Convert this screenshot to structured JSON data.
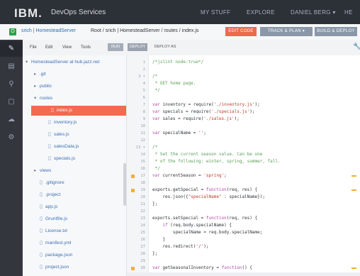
{
  "header": {
    "logo": "IBM.",
    "service": "DevOps Services",
    "nav": [
      "MY STUFF",
      "EXPLORE",
      "DANIEL BERG ▾",
      "HE"
    ]
  },
  "project": {
    "icon_letter": "O",
    "owner": "srich",
    "separator": " | ",
    "name": "HomesteadServer",
    "path": "Root / srich | HomesteadServer / routes / index.js",
    "buttons": {
      "edit": "EDIT CODE",
      "track": "TRACK & PLAN  ▾",
      "build": "BUILD & DEPLOY"
    }
  },
  "rail": {
    "icons": [
      "pencil-icon",
      "clipboard-icon",
      "search-icon",
      "window-icon",
      "cloud-icon",
      "gear-icon"
    ],
    "glyphs": [
      "✎",
      "▤",
      "⚲",
      "▢",
      "☁",
      "⚙"
    ]
  },
  "toolbar": {
    "menus": [
      "File",
      "Edit",
      "View",
      "Tools"
    ],
    "run": "RUN",
    "deploy": "DEPLOY",
    "deploy_as": "DEPLOY AS"
  },
  "tree": [
    {
      "label": "HomesteadServer at hub.jazz.net",
      "depth": 0,
      "kind": "folder-open"
    },
    {
      "label": ".git",
      "depth": 1,
      "kind": "folder"
    },
    {
      "label": "public",
      "depth": 1,
      "kind": "folder"
    },
    {
      "label": "routes",
      "depth": 1,
      "kind": "folder-open"
    },
    {
      "label": "index.js",
      "depth": 2,
      "kind": "file",
      "selected": true
    },
    {
      "label": "inventory.js",
      "depth": 2,
      "kind": "file"
    },
    {
      "label": "sales.js",
      "depth": 2,
      "kind": "file"
    },
    {
      "label": "salesData.js",
      "depth": 2,
      "kind": "file"
    },
    {
      "label": "specials.js",
      "depth": 2,
      "kind": "file"
    },
    {
      "label": "views",
      "depth": 1,
      "kind": "folder"
    },
    {
      "label": ".gitignore",
      "depth": 1,
      "kind": "file"
    },
    {
      "label": ".project",
      "depth": 1,
      "kind": "file"
    },
    {
      "label": "app.js",
      "depth": 1,
      "kind": "file"
    },
    {
      "label": "Gruntfile.js",
      "depth": 1,
      "kind": "file"
    },
    {
      "label": "License.txt",
      "depth": 1,
      "kind": "file"
    },
    {
      "label": "manifest.yml",
      "depth": 1,
      "kind": "file"
    },
    {
      "label": "package.json",
      "depth": 1,
      "kind": "file"
    },
    {
      "label": "project.json",
      "depth": 1,
      "kind": "file"
    }
  ],
  "editor": {
    "lines": [
      {
        "n": "1",
        "seg": [
          [
            "c",
            "/*jslint node:true*/"
          ]
        ]
      },
      {
        "n": "2",
        "seg": []
      },
      {
        "n": "3 ▾",
        "seg": [
          [
            "c",
            "/*"
          ]
        ]
      },
      {
        "n": "4",
        "seg": [
          [
            "c",
            " * GET home page."
          ]
        ]
      },
      {
        "n": "5",
        "seg": [
          [
            "c",
            " */"
          ]
        ]
      },
      {
        "n": "6",
        "seg": []
      },
      {
        "n": "7",
        "seg": [
          [
            "k",
            "var"
          ],
          [
            "t",
            " inventory = require("
          ],
          [
            "s",
            "'./inventory.js'"
          ],
          [
            "t",
            ");"
          ]
        ]
      },
      {
        "n": "8",
        "seg": [
          [
            "k",
            "var"
          ],
          [
            "t",
            " specials = require("
          ],
          [
            "s",
            "'./specials.js'"
          ],
          [
            "t",
            ");"
          ]
        ]
      },
      {
        "n": "9",
        "seg": [
          [
            "k",
            "var"
          ],
          [
            "t",
            " sales = require("
          ],
          [
            "s",
            "'./sales.js'"
          ],
          [
            "t",
            ");"
          ]
        ]
      },
      {
        "n": "10",
        "seg": []
      },
      {
        "n": "11",
        "seg": [
          [
            "k",
            "var"
          ],
          [
            "t",
            " specialName = "
          ],
          [
            "s",
            "''"
          ],
          [
            "t",
            ";"
          ]
        ]
      },
      {
        "n": "12",
        "seg": []
      },
      {
        "n": "13 ▾",
        "seg": [
          [
            "c",
            "/*"
          ]
        ]
      },
      {
        "n": "14",
        "seg": [
          [
            "c",
            " * Set the current season value. Can be one"
          ]
        ]
      },
      {
        "n": "15",
        "seg": [
          [
            "c",
            " * of the following: winter, spring, summer, fall."
          ]
        ]
      },
      {
        "n": "16",
        "seg": [
          [
            "c",
            " */"
          ]
        ]
      },
      {
        "n": "17",
        "seg": [
          [
            "k",
            "var"
          ],
          [
            "t",
            " currentSeason = "
          ],
          [
            "s",
            "'spring'"
          ],
          [
            "t",
            ";"
          ]
        ],
        "warn": true
      },
      {
        "n": "18",
        "seg": []
      },
      {
        "n": "19",
        "seg": [
          [
            "t",
            "exports.getSpecial = "
          ],
          [
            "k",
            "function"
          ],
          [
            "t",
            "(req, res) {"
          ]
        ],
        "warn": true
      },
      {
        "n": "20",
        "seg": [
          [
            "t",
            "    res.json({"
          ],
          [
            "s",
            "\"specialName\""
          ],
          [
            "t",
            " : specialName});"
          ]
        ]
      },
      {
        "n": "21",
        "seg": [
          [
            "t",
            "};"
          ]
        ]
      },
      {
        "n": "22",
        "seg": []
      },
      {
        "n": "23",
        "seg": [
          [
            "t",
            "exports.setSpecial = "
          ],
          [
            "k",
            "function"
          ],
          [
            "t",
            "(req, res) {"
          ]
        ]
      },
      {
        "n": "24",
        "seg": [
          [
            "t",
            "    "
          ],
          [
            "k",
            "if"
          ],
          [
            "t",
            " (req.body.specialName) {"
          ]
        ]
      },
      {
        "n": "25",
        "seg": [
          [
            "t",
            "        specialName = req.body.specialName;"
          ]
        ]
      },
      {
        "n": "26",
        "seg": [
          [
            "t",
            "    }"
          ]
        ]
      },
      {
        "n": "27",
        "seg": [
          [
            "t",
            "    res.redirect("
          ],
          [
            "s",
            "'/'"
          ],
          [
            "t",
            ");"
          ]
        ]
      },
      {
        "n": "28",
        "seg": [
          [
            "t",
            "};"
          ]
        ]
      },
      {
        "n": "29",
        "seg": []
      },
      {
        "n": "30",
        "seg": [
          [
            "k",
            "var"
          ],
          [
            "t",
            " getSeasonalInventory = "
          ],
          [
            "k",
            "function"
          ],
          [
            "t",
            "() {"
          ]
        ],
        "warn": true
      }
    ]
  },
  "colors": {
    "accent": "#f26a4f",
    "header_bg": "#2c3037",
    "warning": "#f2b134"
  }
}
